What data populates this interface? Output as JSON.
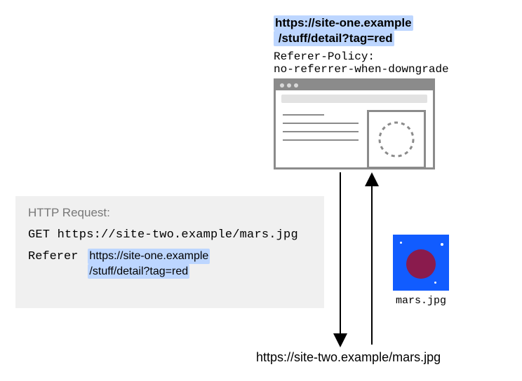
{
  "top": {
    "url_origin": "https://site-one.example",
    "url_path": "/stuff/detail?tag=red"
  },
  "policy": {
    "header": "Referer-Policy:",
    "value": "no-referrer-when-downgrade"
  },
  "request": {
    "title": "HTTP Request:",
    "method_line": "GET https://site-two.example/mars.jpg",
    "referer_label": "Referer",
    "referer_origin": "https://site-one.example",
    "referer_path": "/stuff/detail?tag=red"
  },
  "image": {
    "filename": "mars.jpg"
  },
  "target_url": "https://site-two.example/mars.jpg"
}
